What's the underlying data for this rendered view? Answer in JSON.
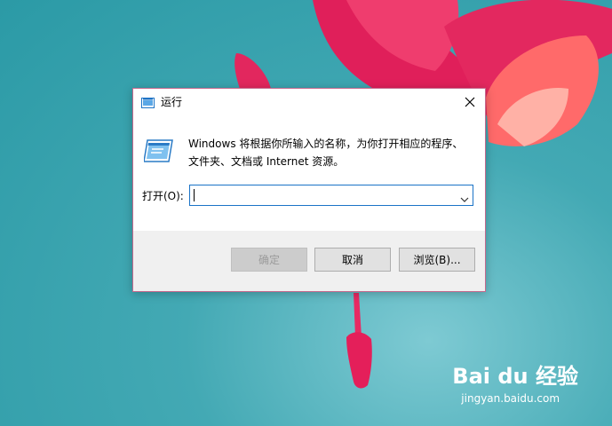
{
  "dialog": {
    "title": "运行",
    "description": "Windows 将根据你所输入的名称，为你打开相应的程序、文件夹、文档或 Internet 资源。",
    "open_label": "打开(O):",
    "input_value": "",
    "buttons": {
      "ok": "确定",
      "cancel": "取消",
      "browse": "浏览(B)..."
    },
    "icons": {
      "app": "run-app-icon",
      "close": "close-icon",
      "run": "run-program-icon",
      "dropdown": "chevron-down-icon"
    }
  },
  "watermark": {
    "logo": "Bai du 经验",
    "url": "jingyan.baidu.com"
  },
  "colors": {
    "desktop": "#2b9aa6",
    "flower": "#e0245e",
    "dialog_border": "#c5698d",
    "input_focus": "#1a73c7",
    "footer": "#f0f0f0"
  }
}
